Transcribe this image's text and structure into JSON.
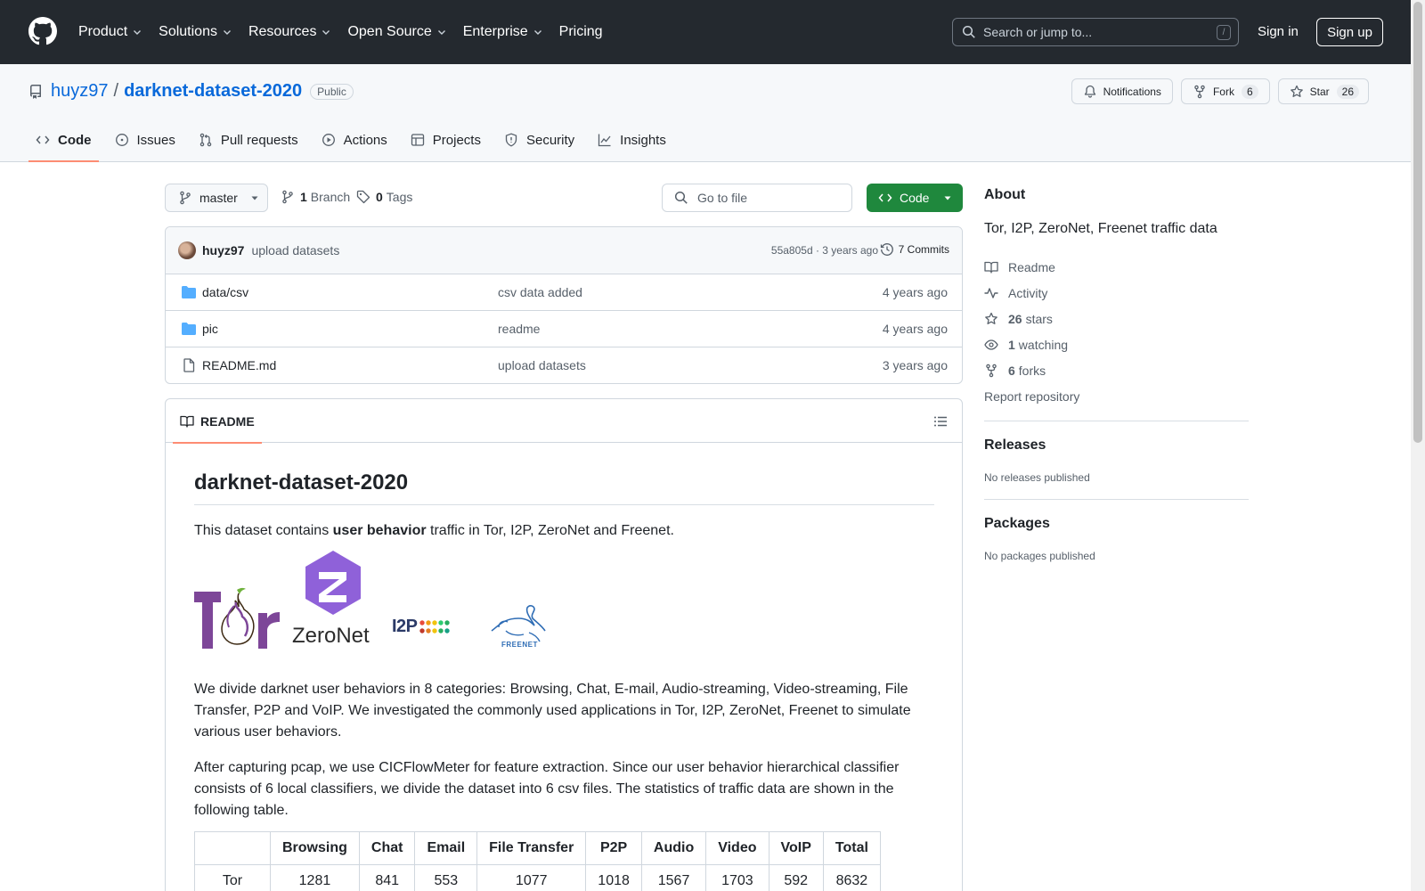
{
  "header": {
    "nav": [
      "Product",
      "Solutions",
      "Resources",
      "Open Source",
      "Enterprise",
      "Pricing"
    ],
    "search_placeholder": "Search or jump to...",
    "search_shortcut": "/",
    "signin": "Sign in",
    "signup": "Sign up"
  },
  "repo": {
    "owner": "huyz97",
    "separator": "/",
    "name": "darknet-dataset-2020",
    "visibility": "Public",
    "notifications": "Notifications",
    "fork_label": "Fork",
    "fork_count": "6",
    "star_label": "Star",
    "star_count": "26"
  },
  "tabs": [
    "Code",
    "Issues",
    "Pull requests",
    "Actions",
    "Projects",
    "Security",
    "Insights"
  ],
  "toolbar": {
    "branch": "master",
    "branch_count": "1",
    "branch_label": "Branch",
    "tag_count": "0",
    "tag_label": "Tags",
    "goto_placeholder": "Go to file",
    "code_button": "Code"
  },
  "commit": {
    "user": "huyz97",
    "message": "upload datasets",
    "meta": "55a805d · 3 years ago",
    "commits": "7 Commits"
  },
  "files": [
    {
      "name": "data/csv",
      "type": "folder",
      "message": "csv data added",
      "age": "4 years ago"
    },
    {
      "name": "pic",
      "type": "folder",
      "message": "readme",
      "age": "4 years ago"
    },
    {
      "name": "README.md",
      "type": "file",
      "message": "upload datasets",
      "age": "3 years ago"
    }
  ],
  "readme": {
    "tab": "README",
    "title": "darknet-dataset-2020",
    "p1_pre": "This dataset contains ",
    "p1_bold": "user behavior",
    "p1_post": " traffic in Tor, I2P, ZeroNet and Freenet.",
    "logos": {
      "tor": "Tor",
      "zeronet": "ZeroNet",
      "i2p": "I2P",
      "freenet": "FREENET"
    },
    "p2": "We divide darknet user behaviors in 8 categories: Browsing, Chat, E-mail, Audio-streaming, Video-streaming, File Transfer, P2P and VoIP. We investigated the commonly used applications in Tor, I2P, ZeroNet, Freenet to simulate various user behaviors.",
    "p3": "After capturing pcap, we use CICFlowMeter for feature extraction. Since our user behavior hierarchical classifier consists of 6 local classifiers, we divide the dataset into 6 csv files. The statistics of traffic data are shown in the following table.",
    "table": {
      "headers": [
        "",
        "Browsing",
        "Chat",
        "Email",
        "File Transfer",
        "P2P",
        "Audio",
        "Video",
        "VoIP",
        "Total"
      ],
      "rows": [
        [
          "Tor",
          "1281",
          "841",
          "553",
          "1077",
          "1018",
          "1567",
          "1703",
          "592",
          "8632"
        ]
      ]
    }
  },
  "sidebar": {
    "about": "About",
    "description": "Tor, I2P, ZeroNet, Freenet traffic data",
    "readme": "Readme",
    "activity": "Activity",
    "stars_count": "26",
    "stars_label": "stars",
    "watching_count": "1",
    "watching_label": "watching",
    "forks_count": "6",
    "forks_label": "forks",
    "report": "Report repository",
    "releases": "Releases",
    "no_releases": "No releases published",
    "packages": "Packages",
    "no_packages": "No packages published"
  },
  "colors": {
    "header_bg": "#24292f",
    "link": "#0969da",
    "primary_button": "#1f883d",
    "tab_underline": "#fd8c73",
    "folder": "#54aeff",
    "tor_purple": "#7d4698",
    "zeronet_purple": "#8f61d9"
  }
}
